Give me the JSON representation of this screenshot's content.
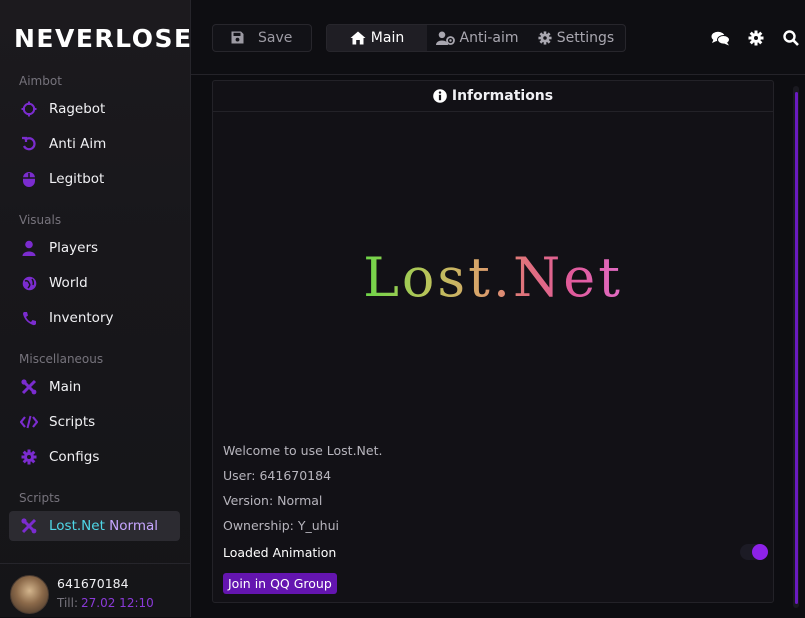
{
  "app": {
    "logo": "NEVERLOSE"
  },
  "sidebar": {
    "sections": [
      {
        "title": "Aimbot",
        "items": [
          {
            "label": "Ragebot",
            "icon": "crosshair-icon"
          },
          {
            "label": "Anti Aim",
            "icon": "rotate-arrow-icon"
          },
          {
            "label": "Legitbot",
            "icon": "mouse-icon"
          }
        ]
      },
      {
        "title": "Visuals",
        "items": [
          {
            "label": "Players",
            "icon": "user-icon"
          },
          {
            "label": "World",
            "icon": "globe-icon"
          },
          {
            "label": "Inventory",
            "icon": "phone-icon"
          }
        ]
      },
      {
        "title": "Miscellaneous",
        "items": [
          {
            "label": "Main",
            "icon": "tools-icon"
          },
          {
            "label": "Scripts",
            "icon": "code-icon"
          },
          {
            "label": "Configs",
            "icon": "gear-icon"
          }
        ]
      },
      {
        "title": "Scripts",
        "items": [
          {
            "label_a": "Lost.Net",
            "label_b": "Normal",
            "icon": "tools-icon",
            "active": true
          }
        ]
      }
    ],
    "footer": {
      "user": "641670184",
      "till_label": "Till:",
      "till_value": "27.02 12:10"
    }
  },
  "topbar": {
    "save_label": "Save",
    "tabs": [
      {
        "label": "Main",
        "icon": "home-icon"
      },
      {
        "label": "Anti-aim",
        "icon": "user-gear-icon"
      },
      {
        "label": "Settings",
        "icon": "gear-icon"
      }
    ],
    "icons": [
      "chat-icon",
      "gear-icon",
      "search-icon"
    ]
  },
  "panel": {
    "header": "Informations",
    "big_title": "Lost.Net",
    "lines": [
      "Welcome to use Lost.Net.",
      "User: 641670184",
      "Version: Normal",
      "Ownership: Y_uhui"
    ],
    "loaded_animation_label": "Loaded Animation",
    "loaded_animation_enabled": true,
    "qq_button": "Join in QQ Group"
  },
  "colors": {
    "accent": "#8d22e8",
    "icon_accent": "#7b2ccf",
    "active_a": "#4fd8e8",
    "active_b": "#c7a6ff"
  }
}
